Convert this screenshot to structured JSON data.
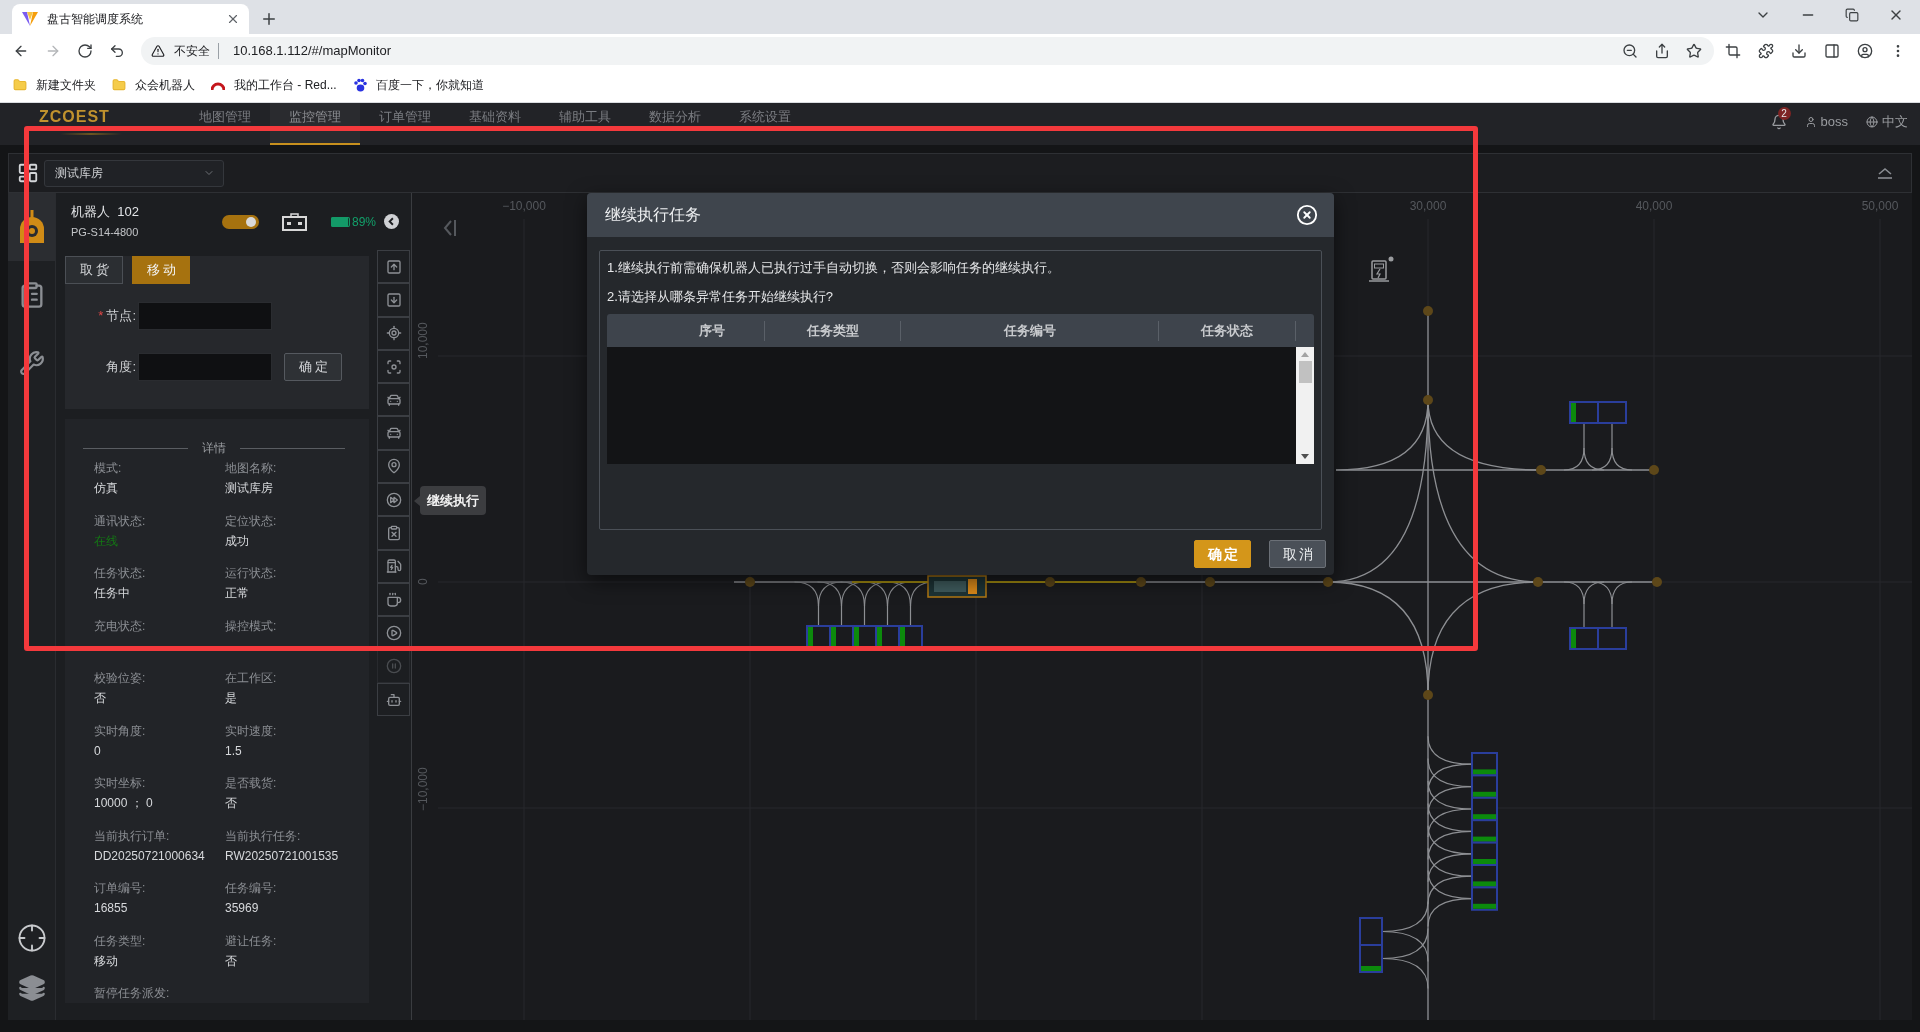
{
  "browser": {
    "tab": {
      "title": "盘古智能调度系统"
    },
    "address": {
      "security_label": "不安全",
      "url": "10.168.1.112/#/mapMonitor"
    },
    "bookmarks": [
      {
        "kind": "folder",
        "label": "新建文件夹"
      },
      {
        "kind": "folder",
        "label": "众会机器人"
      },
      {
        "kind": "arc",
        "label": "我的工作台 - Red..."
      },
      {
        "kind": "paw",
        "label": "百度一下，你就知道"
      }
    ]
  },
  "top_nav": {
    "logo": "ZCOEST",
    "items": [
      {
        "label": "地图管理",
        "selected": false
      },
      {
        "label": "监控管理",
        "selected": true
      },
      {
        "label": "订单管理",
        "selected": false
      },
      {
        "label": "基础资料",
        "selected": false
      },
      {
        "label": "辅助工具",
        "selected": false
      },
      {
        "label": "数据分析",
        "selected": false
      },
      {
        "label": "系统设置",
        "selected": false
      }
    ],
    "notification_count": "2",
    "user": "boss",
    "language": "中文"
  },
  "map_selector": {
    "value": "测试库房"
  },
  "side_nav": [
    {
      "selected": true
    },
    {
      "selected": false
    },
    {
      "selected": false
    }
  ],
  "robot": {
    "name": "机器人  102",
    "code": "PG-S14-4800",
    "on": true,
    "battery": {
      "level": 0.89,
      "reading": "89%"
    }
  },
  "action_tabs": [
    {
      "label": "取货",
      "selected": false
    },
    {
      "label": "移动",
      "selected": true
    }
  ],
  "move_form": {
    "fields": [
      {
        "label": "节点:",
        "required_mark": "*"
      },
      {
        "label": "角度:"
      }
    ],
    "submit": "确定"
  },
  "details": {
    "title": "详情",
    "items": [
      {
        "label": "模式:",
        "value": "仿真"
      },
      {
        "label": "地图名称:",
        "value": "测试库房"
      },
      {
        "label": "通讯状态:",
        "value": "在线",
        "color": "#137a13"
      },
      {
        "label": "定位状态:",
        "value": "成功"
      },
      {
        "label": "任务状态:",
        "value": "任务中"
      },
      {
        "label": "运行状态:",
        "value": "正常"
      },
      {
        "label": "充电状态:"
      },
      {
        "label": "操控模式:"
      },
      {
        "label": "校验位姿:",
        "value": "否"
      },
      {
        "label": "在工作区:",
        "value": "是"
      },
      {
        "label": "实时角度:",
        "value": "0"
      },
      {
        "label": "实时速度:",
        "value": "1.5"
      },
      {
        "label": "实时坐标:",
        "value": "10000 ； 0"
      },
      {
        "label": "是否载货:",
        "value": "否"
      },
      {
        "label": "当前执行订单:",
        "value": "DD20250721000634"
      },
      {
        "label": "当前执行任务:",
        "value": "RW20250721001535"
      },
      {
        "label": "订单编号:",
        "value": "16855"
      },
      {
        "label": "任务编号:",
        "value": "35969"
      },
      {
        "label": "任务类型:",
        "value": "移动"
      },
      {
        "label": "避让任务:",
        "value": "否"
      },
      {
        "label": "暂停任务派发:"
      }
    ]
  },
  "toolbar": {
    "buttons": [
      {
        "disabled": false
      },
      {
        "disabled": false
      },
      {
        "disabled": false
      },
      {
        "disabled": false
      },
      {
        "disabled": false
      },
      {
        "disabled": false
      },
      {
        "disabled": false
      },
      {
        "disabled": false,
        "tooltip": "继续执行"
      },
      {
        "disabled": false
      },
      {
        "disabled": false
      },
      {
        "disabled": false
      },
      {
        "disabled": false
      },
      {
        "disabled": true
      },
      {
        "disabled": false
      }
    ]
  },
  "map": {
    "x_ticks": [
      "−10,000",
      "30,000",
      "40,000",
      "50,000"
    ],
    "y_ticks": [
      "10,000",
      "0",
      "−10,000"
    ],
    "storage_groups": [
      {
        "slots": [
          {
            "occupied": true
          },
          {
            "occupied": true
          },
          {
            "occupied": true
          },
          {
            "occupied": true
          },
          {
            "occupied": true
          }
        ]
      },
      {
        "slots": [
          {
            "occupied": true
          },
          {
            "occupied": false
          }
        ]
      },
      {
        "slots": [
          {
            "occupied": true
          },
          {
            "occupied": false
          }
        ]
      },
      {
        "slots": [
          {
            "occupied": true
          },
          {
            "occupied": true
          },
          {
            "occupied": true
          },
          {
            "occupied": true
          },
          {
            "occupied": true
          },
          {
            "occupied": true
          },
          {
            "occupied": true
          }
        ]
      },
      {
        "slots": [
          {
            "occupied": false
          },
          {
            "occupied": true
          }
        ]
      }
    ]
  },
  "dialog": {
    "title": "继续执行任务",
    "notes": [
      "1.继续执行前需确保机器人已执行过手自动切换，否则会影响任务的继续执行。",
      "2.请选择从哪条异常任务开始继续执行?"
    ],
    "table": {
      "columns": [
        "序号",
        "任务类型",
        "任务编号",
        "任务状态"
      ]
    },
    "buttons": [
      {
        "label": "确定",
        "kind": "primary"
      },
      {
        "label": "取消",
        "kind": "secondary"
      }
    ]
  }
}
